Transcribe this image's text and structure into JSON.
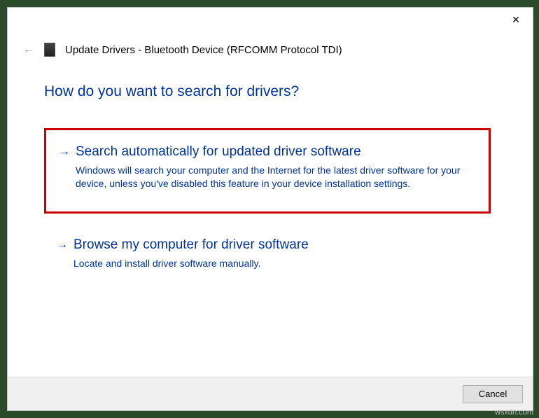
{
  "window": {
    "title": "Update Drivers - Bluetooth Device (RFCOMM Protocol TDI)"
  },
  "heading": "How do you want to search for drivers?",
  "options": [
    {
      "title": "Search automatically for updated driver software",
      "description": "Windows will search your computer and the Internet for the latest driver software for your device, unless you've disabled this feature in your device installation settings.",
      "highlighted": true
    },
    {
      "title": "Browse my computer for driver software",
      "description": "Locate and install driver software manually.",
      "highlighted": false
    }
  ],
  "footer": {
    "cancel": "Cancel"
  },
  "watermark": "wsxdn.com"
}
